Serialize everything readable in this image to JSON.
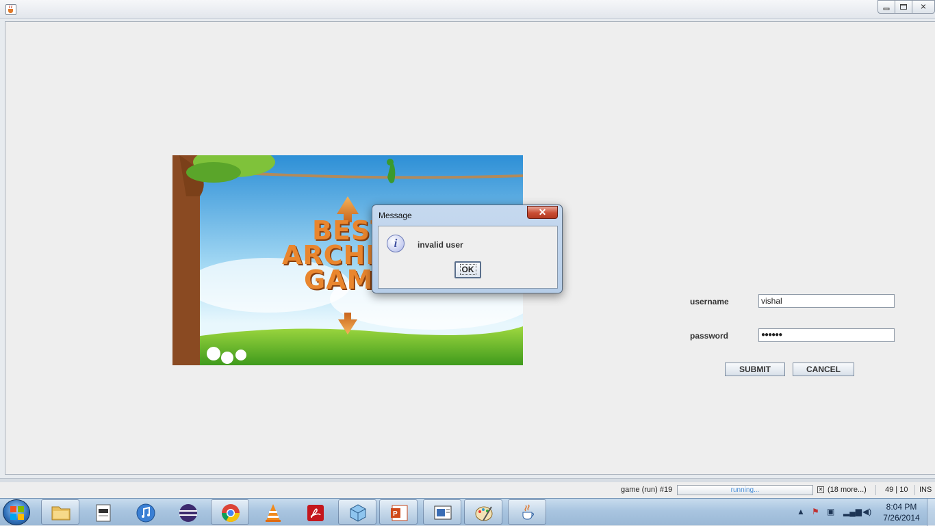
{
  "window": {
    "app_icon": "java-cup-icon",
    "controls": [
      "minimize-icon",
      "maximize-icon",
      "close-icon"
    ]
  },
  "banner": {
    "title_line1": "BEST",
    "title_line2": "ARCHER",
    "title_line3": "GAME"
  },
  "login": {
    "username_label": "username",
    "username_value": "vishal",
    "password_label": "password",
    "password_value": "●●●●●●",
    "submit_label": "SUBMIT",
    "cancel_label": "CANCEL"
  },
  "dialog": {
    "title": "Message",
    "close_glyph": "✕",
    "icon": "info-icon",
    "message": "invalid user",
    "ok_label": "OK"
  },
  "statusbar": {
    "run_label": "game (run) #19",
    "progress_text": "running...",
    "more_label": "(18 more...)",
    "cursor_position": "49 | 10",
    "insert_mode": "INS"
  },
  "taskbar": {
    "pinned": [
      "start-orb-icon",
      "file-explorer-icon",
      "notepad-icon",
      "itunes-icon",
      "eclipse-icon",
      "chrome-icon",
      "vlc-icon",
      "adobe-reader-icon",
      "virtualbox-icon",
      "powerpoint-icon",
      "presentation-icon",
      "paint-icon",
      "java-icon"
    ],
    "tray_icons": [
      "show-hidden-icons",
      "action-center-icon",
      "device-icon",
      "network-icon",
      "volume-icon"
    ],
    "time": "8:04 PM",
    "date": "7/26/2014"
  }
}
